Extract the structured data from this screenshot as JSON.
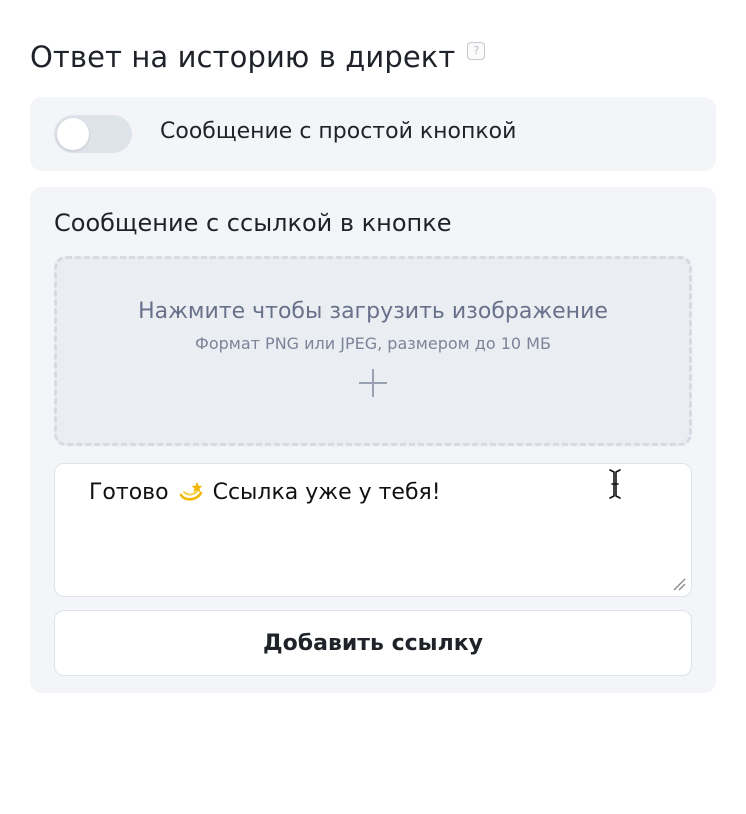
{
  "header": {
    "title": "Ответ на историю в директ",
    "help_glyph": "?"
  },
  "simple_button_card": {
    "toggle_on": false,
    "label": "Сообщение с простой кнопкой"
  },
  "link_button_card": {
    "title": "Сообщение с ссылкой в кнопке",
    "upload": {
      "title": "Нажмите чтобы загрузить изображение",
      "hint": "Формат PNG или JPEG, размером до 10 МБ",
      "icon": "plus-icon"
    },
    "message": {
      "text_before_emoji": "Готово",
      "emoji_icon": "dizzy-star-emoji",
      "text_after_emoji": "Ссылка уже у тебя!"
    },
    "add_link_label": "Добавить ссылку"
  },
  "colors": {
    "card_background": "#f3f5f8",
    "toggle_track": "#dfe3ea",
    "upload_text": "#68718a",
    "emoji_gold": "#f2b705"
  }
}
